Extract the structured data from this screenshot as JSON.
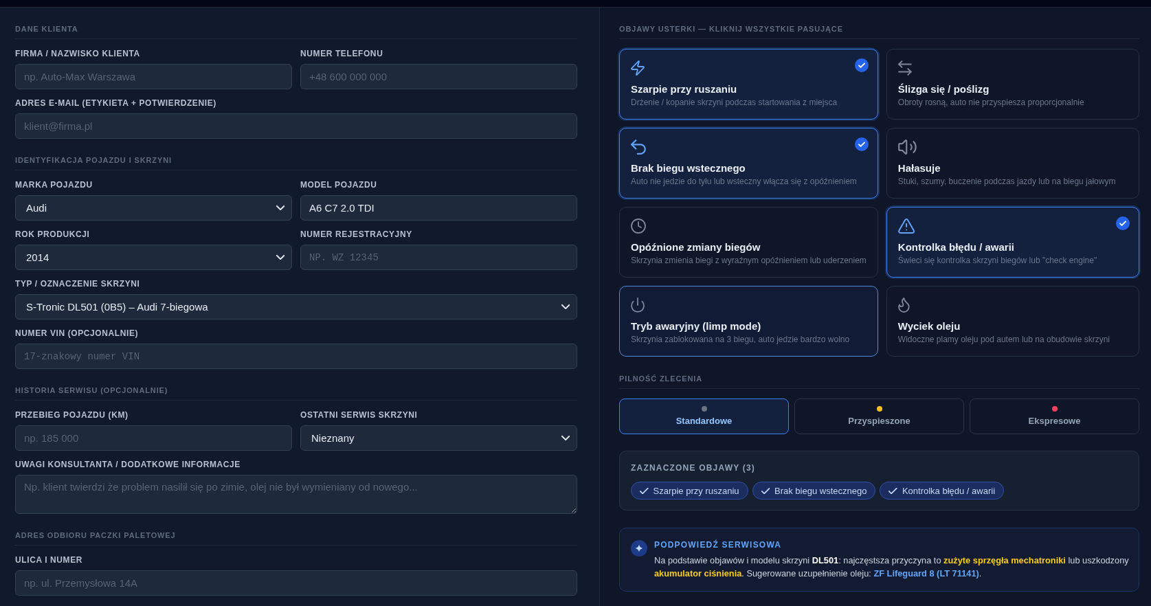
{
  "form": {
    "sections": [
      {
        "title": "DANE KLIENTA",
        "rows": [
          [
            {
              "label": "FIRMA / NAZWISKO KLIENTA",
              "kind": "text",
              "placeholder": "np. Auto-Max Warszawa"
            },
            {
              "label": "NUMER TELEFONU",
              "kind": "text",
              "placeholder": "+48 600 000 000"
            }
          ],
          [
            {
              "label": "ADRES E-MAIL (ETYKIETA + POTWIERDZENIE)",
              "kind": "text",
              "placeholder": "klient@firma.pl"
            }
          ]
        ]
      },
      {
        "title": "IDENTYFIKACJA POJAZDU I SKRZYNI",
        "rows": [
          [
            {
              "label": "MARKA POJAZDU",
              "kind": "select",
              "value": "Audi"
            },
            {
              "label": "MODEL POJAZDU",
              "kind": "text",
              "value": "A6 C7 2.0 TDI"
            }
          ],
          [
            {
              "label": "ROK PRODUKCJI",
              "kind": "select",
              "value": "2014"
            },
            {
              "label": "NUMER REJESTRACYJNY",
              "kind": "mono",
              "placeholder": "NP. WZ 12345"
            }
          ],
          [
            {
              "label": "TYP / OZNACZENIE SKRZYNI",
              "kind": "select",
              "value": "S-Tronic DL501 (0B5) – Audi 7-biegowa"
            }
          ],
          [
            {
              "label": "NUMER VIN (OPCJONALNIE)",
              "kind": "mono",
              "placeholder": "17-znakowy numer VIN"
            }
          ]
        ]
      },
      {
        "title": "HISTORIA SERWISU (OPCJONALNIE)",
        "rows": [
          [
            {
              "label": "PRZEBIEG POJAZDU (KM)",
              "kind": "text",
              "placeholder": "np. 185 000"
            },
            {
              "label": "OSTATNI SERWIS SKRZYNI",
              "kind": "select",
              "value": "Nieznany"
            }
          ],
          [
            {
              "label": "UWAGI KONSULTANTA / DODATKOWE INFORMACJE",
              "kind": "textarea",
              "placeholder": "Np. klient twierdzi że problem nasilił się po zimie, olej nie był wymieniany od nowego..."
            }
          ]
        ]
      },
      {
        "title": "ADRES ODBIORU PACZKI PALETOWEJ",
        "rows": [
          [
            {
              "label": "ULICA I NUMER",
              "kind": "text",
              "placeholder": "np. ul. Przemysłowa 14A"
            }
          ]
        ]
      }
    ]
  },
  "symptoms": {
    "title": "OBJAWY USTERKI — KLIKNIJ WSZYSTKIE PASUJĄCE",
    "cards": [
      {
        "title": "Szarpie przy ruszaniu",
        "description": "Drżenie / kopanie skrzyni podczas startowania z miejsca",
        "selected": true,
        "hovered": false
      },
      {
        "title": "Ślizga się / poślizg",
        "description": "Obroty rosną, auto nie przyspiesza proporcjonalnie",
        "selected": false,
        "hovered": false
      },
      {
        "title": "Brak biegu wstecznego",
        "description": "Auto nie jedzie do tyłu lub wsteczny włącza się z opóźnieniem",
        "selected": true,
        "hovered": false
      },
      {
        "title": "Hałasuje",
        "description": "Stuki, szumy, buczenie podczas jazdy lub na biegu jałowym",
        "selected": false,
        "hovered": false
      },
      {
        "title": "Opóźnione zmiany biegów",
        "description": "Skrzynia zmienia biegi z wyraźnym opóźnieniem lub uderzeniem",
        "selected": false,
        "hovered": false
      },
      {
        "title": "Kontrolka błędu / awarii",
        "description": "Świeci się kontrolka skrzyni biegów lub \"check engine\"",
        "selected": true,
        "hovered": false
      },
      {
        "title": "Tryb awaryjny (limp mode)",
        "description": "Skrzynia zablokowana na 3 biegu, auto jedzie bardzo wolno",
        "selected": false,
        "hovered": true
      },
      {
        "title": "Wyciek oleju",
        "description": "Widoczne plamy oleju pod autem lub na obudowie skrzyni",
        "selected": false,
        "hovered": false
      }
    ]
  },
  "priority": {
    "title": "PILNOŚĆ ZLECENIA",
    "options": [
      {
        "label": "Standardowe",
        "selected": true,
        "color": "#6b7280"
      },
      {
        "label": "Przyspieszone",
        "selected": false,
        "color": "#fbbf24"
      },
      {
        "label": "Ekspresowe",
        "selected": false,
        "color": "#f43f5e"
      }
    ]
  },
  "selected_symptoms": {
    "title": "ZAZNACZONE OBJAWY (3)",
    "chips": [
      {
        "label": "Szarpie przy ruszaniu"
      },
      {
        "label": "Brak biegu wstecznego"
      },
      {
        "label": "Kontrolka błędu / awarii"
      }
    ]
  },
  "service_hint": {
    "title": "PODPOWIEDŹ SERWISOWA",
    "segments": [
      {
        "kind": "text",
        "text": "Na podstawie objawów i modelu skrzyni "
      },
      {
        "kind": "model",
        "text": "DL501"
      },
      {
        "kind": "text",
        "text": ": najczęstsza przyczyna to "
      },
      {
        "kind": "warning",
        "text": "zużyte sprzęgła mechatroniki"
      },
      {
        "kind": "text",
        "text": " lub uszkodzony "
      },
      {
        "kind": "warning",
        "text": "akumulator ciśnienia"
      },
      {
        "kind": "text",
        "text": ". Sugerowane uzupełnienie oleju: "
      },
      {
        "kind": "product",
        "text": "ZF Lifeguard 8 (LT 71141)"
      },
      {
        "kind": "text",
        "text": "."
      }
    ]
  }
}
